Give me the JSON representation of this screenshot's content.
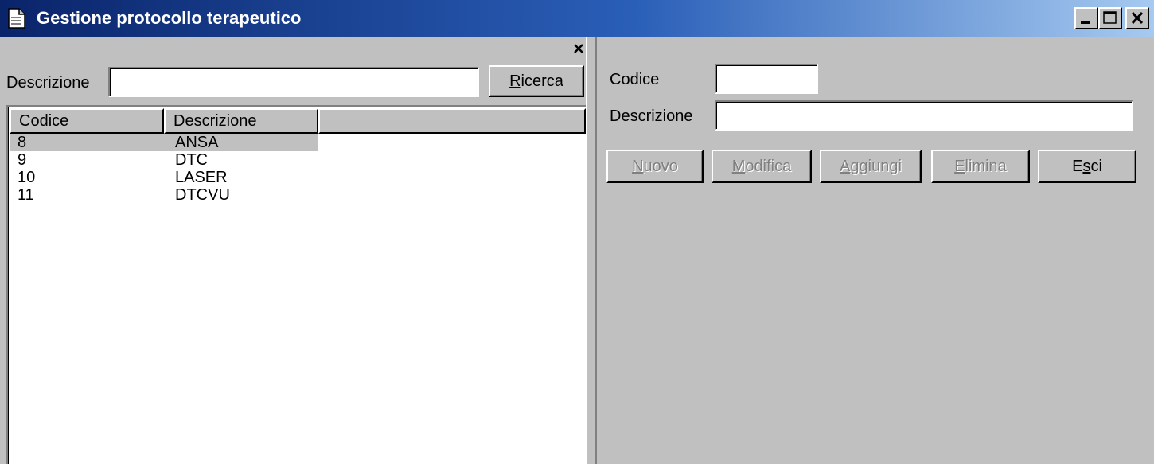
{
  "window": {
    "title": "Gestione protocollo terapeutico"
  },
  "icons": {
    "window": "document-icon",
    "minimize": "minimize-icon",
    "maximize": "maximize-icon",
    "close": "close-icon"
  },
  "search": {
    "label": "Descrizione",
    "value": "",
    "button_pre": "",
    "button_acc": "R",
    "button_post": "icerca"
  },
  "list": {
    "columns": [
      "Codice",
      "Descrizione"
    ],
    "rows": [
      {
        "codice": "8",
        "descrizione": "ANSA",
        "selected": true
      },
      {
        "codice": "9",
        "descrizione": "DTC",
        "selected": false
      },
      {
        "codice": "10",
        "descrizione": "LASER",
        "selected": false
      },
      {
        "codice": "11",
        "descrizione": "DTCVU",
        "selected": false
      }
    ]
  },
  "detail": {
    "codice_label": "Codice",
    "codice_value": "",
    "descrizione_label": "Descrizione",
    "descrizione_value": ""
  },
  "actions": [
    {
      "id": "nuovo",
      "pre": "",
      "acc": "N",
      "post": "uovo",
      "disabled": true
    },
    {
      "id": "modifica",
      "pre": "",
      "acc": "M",
      "post": "odifica",
      "disabled": true
    },
    {
      "id": "aggiungi",
      "pre": "",
      "acc": "A",
      "post": "ggiungi",
      "disabled": true
    },
    {
      "id": "elimina",
      "pre": "",
      "acc": "E",
      "post": "limina",
      "disabled": true
    },
    {
      "id": "esci",
      "pre": "E",
      "acc": "s",
      "post": "ci",
      "disabled": false
    }
  ],
  "colors": {
    "face": "#c0c0c0",
    "title_start": "#0a246a",
    "title_end": "#a6caf0",
    "disabled_text": "#808080"
  }
}
